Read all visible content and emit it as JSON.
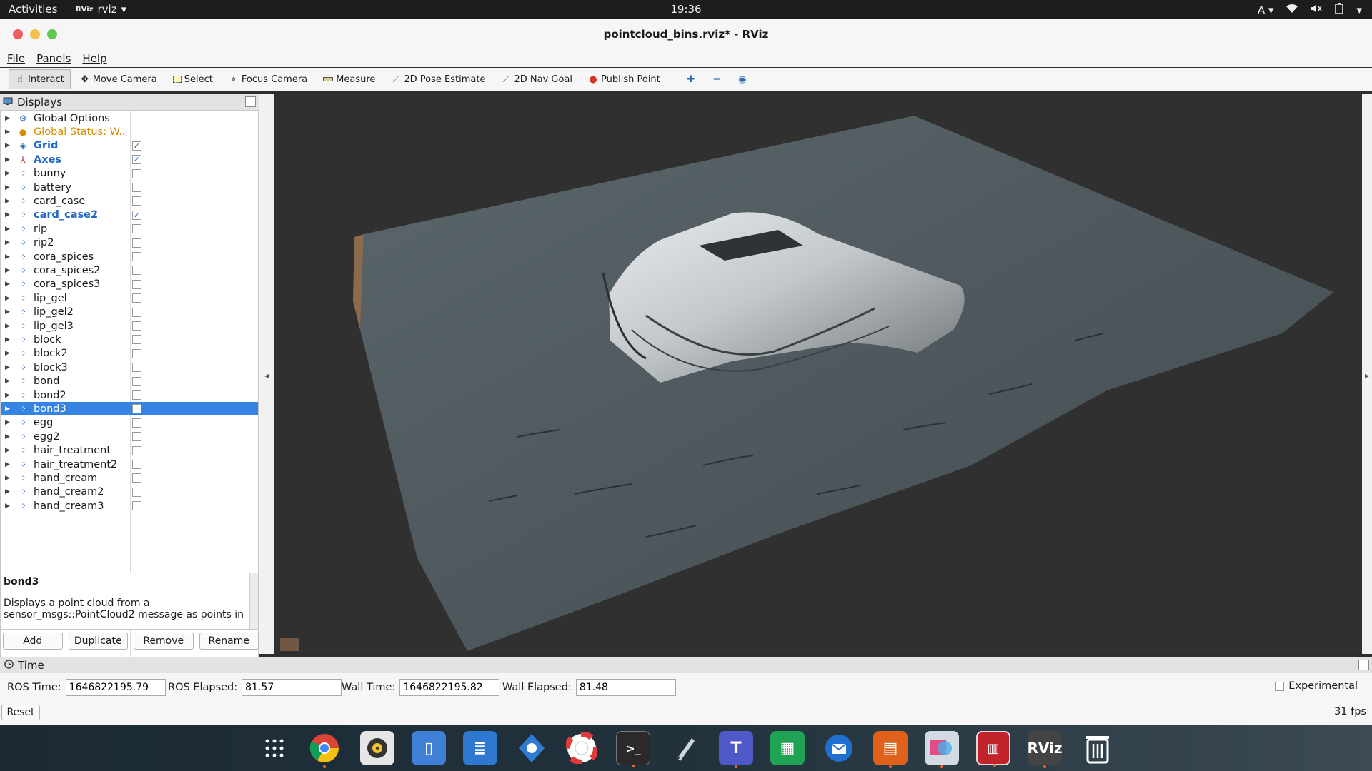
{
  "topbar": {
    "activities": "Activities",
    "app_name": "rviz",
    "app_badge": "RViz",
    "clock": "19:36",
    "input_lang": "A"
  },
  "window": {
    "title": "pointcloud_bins.rviz* - RViz"
  },
  "menu": {
    "file": "File",
    "panels": "Panels",
    "help": "Help"
  },
  "toolbar": {
    "interact": "Interact",
    "move_camera": "Move Camera",
    "select": "Select",
    "focus_camera": "Focus Camera",
    "measure": "Measure",
    "pose_estimate": "2D Pose Estimate",
    "nav_goal": "2D Nav Goal",
    "publish_point": "Publish Point"
  },
  "displays": {
    "title": "Displays",
    "items": [
      {
        "label": "Global Options",
        "checked": null,
        "style": "normal",
        "icon": "gear-icon"
      },
      {
        "label": "Global Status: W...",
        "checked": null,
        "style": "orange",
        "icon": "warning-icon"
      },
      {
        "label": "Grid",
        "checked": true,
        "style": "blue",
        "icon": "grid-icon"
      },
      {
        "label": "Axes",
        "checked": true,
        "style": "blue",
        "icon": "axes-icon"
      },
      {
        "label": "bunny",
        "checked": false,
        "style": "normal",
        "icon": "pointcloud-icon"
      },
      {
        "label": "battery",
        "checked": false,
        "style": "normal",
        "icon": "pointcloud-icon"
      },
      {
        "label": "card_case",
        "checked": false,
        "style": "normal",
        "icon": "pointcloud-icon"
      },
      {
        "label": "card_case2",
        "checked": true,
        "style": "blue",
        "icon": "pointcloud-icon"
      },
      {
        "label": "rip",
        "checked": false,
        "style": "normal",
        "icon": "pointcloud-icon"
      },
      {
        "label": "rip2",
        "checked": false,
        "style": "normal",
        "icon": "pointcloud-icon"
      },
      {
        "label": "cora_spices",
        "checked": false,
        "style": "normal",
        "icon": "pointcloud-icon"
      },
      {
        "label": "cora_spices2",
        "checked": false,
        "style": "normal",
        "icon": "pointcloud-icon"
      },
      {
        "label": "cora_spices3",
        "checked": false,
        "style": "normal",
        "icon": "pointcloud-icon"
      },
      {
        "label": "lip_gel",
        "checked": false,
        "style": "normal",
        "icon": "pointcloud-icon"
      },
      {
        "label": "lip_gel2",
        "checked": false,
        "style": "normal",
        "icon": "pointcloud-icon"
      },
      {
        "label": "lip_gel3",
        "checked": false,
        "style": "normal",
        "icon": "pointcloud-icon"
      },
      {
        "label": "block",
        "checked": false,
        "style": "normal",
        "icon": "pointcloud-icon"
      },
      {
        "label": "block2",
        "checked": false,
        "style": "normal",
        "icon": "pointcloud-icon"
      },
      {
        "label": "block3",
        "checked": false,
        "style": "normal",
        "icon": "pointcloud-icon"
      },
      {
        "label": "bond",
        "checked": false,
        "style": "normal",
        "icon": "pointcloud-icon"
      },
      {
        "label": "bond2",
        "checked": false,
        "style": "normal",
        "icon": "pointcloud-icon"
      },
      {
        "label": "bond3",
        "checked": false,
        "style": "selected",
        "icon": "pointcloud-icon"
      },
      {
        "label": "egg",
        "checked": false,
        "style": "normal",
        "icon": "pointcloud-icon"
      },
      {
        "label": "egg2",
        "checked": false,
        "style": "normal",
        "icon": "pointcloud-icon"
      },
      {
        "label": "hair_treatment",
        "checked": false,
        "style": "normal",
        "icon": "pointcloud-icon"
      },
      {
        "label": "hair_treatment2",
        "checked": false,
        "style": "normal",
        "icon": "pointcloud-icon"
      },
      {
        "label": "hand_cream",
        "checked": false,
        "style": "normal",
        "icon": "pointcloud-icon"
      },
      {
        "label": "hand_cream2",
        "checked": false,
        "style": "normal",
        "icon": "pointcloud-icon"
      },
      {
        "label": "hand_cream3",
        "checked": false,
        "style": "normal",
        "icon": "pointcloud-icon"
      }
    ]
  },
  "description": {
    "title": "bond3",
    "text": "Displays a point cloud from a sensor_msgs::PointCloud2 message as points in"
  },
  "buttons": {
    "add": "Add",
    "duplicate": "Duplicate",
    "remove": "Remove",
    "rename": "Rename"
  },
  "time": {
    "title": "Time",
    "ros_time_label": "ROS Time:",
    "ros_time": "1646822195.79",
    "ros_elapsed_label": "ROS Elapsed:",
    "ros_elapsed": "81.57",
    "wall_time_label": "Wall Time:",
    "wall_time": "1646822195.82",
    "wall_elapsed_label": "Wall Elapsed:",
    "wall_elapsed": "81.48",
    "experimental": "Experimental",
    "reset": "Reset",
    "fps": "31 fps"
  },
  "dock": {
    "rviz_label": "RViz"
  },
  "colors": {
    "selection": "#3584e4",
    "checked_blue": "#1e66c8",
    "warning": "#d98c00"
  }
}
